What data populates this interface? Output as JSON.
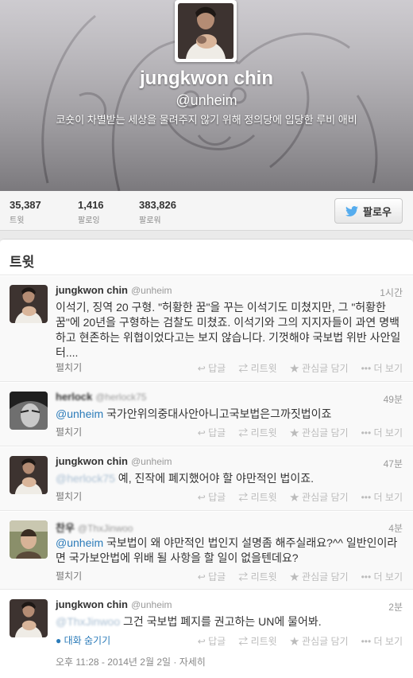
{
  "profile": {
    "name": "jungkwon chin",
    "handle": "@unheim",
    "bio": "코숏이 차별받는 세상을 물려주지 않기 위해 정의당에 입당한 루비 애비"
  },
  "stats": [
    {
      "num": "35,387",
      "label": "트윗"
    },
    {
      "num": "1,416",
      "label": "팔로잉"
    },
    {
      "num": "383,826",
      "label": "팔로워"
    }
  ],
  "follow_label": "팔로우",
  "timeline_title": "트윗",
  "actions": {
    "reply": "답글",
    "retweet": "리트윗",
    "favorite": "관심글 담기",
    "more": "더 보기"
  },
  "expand_label": "펼치기",
  "collapse_label": "대화 숨기기",
  "tweets": [
    {
      "name": "jungkwon chin",
      "screen_name": "@unheim",
      "time": "1시간",
      "text": "이석기, 징역 20 구형. \"허황한 꿈\"을 꾸는 이석기도 미쳤지만, 그 \"허황한 꿈\"에 20년을 구형하는 검찰도 미쳤죠. 이석기와 그의 지지자들이 과연 명백하고 현존하는 위협이었다고는 보지 않습니다. 기껏해야 국보법 위반 사안일 터...."
    },
    {
      "name": "herlock",
      "screen_name": "@herlock75",
      "time": "49분",
      "mention": "@unheim",
      "text": " 국가안위의중대사안아니고국보법은그까짓법이죠"
    },
    {
      "name": "jungkwon chin",
      "screen_name": "@unheim",
      "time": "47분",
      "mention": "@herlock75",
      "text": " 예, 진작에 폐지했어야 할 야만적인 법이죠."
    },
    {
      "name": "찬우",
      "screen_name": "@ThxJinwoo",
      "time": "4분",
      "mention": "@unheim",
      "text": " 국보법이 왜 야만적인 법인지 설명좀 해주실래요?^^ 일반인이라면 국가보안법에 위배 될 사항을 할 일이 없을텐데요?"
    },
    {
      "name": "jungkwon chin",
      "screen_name": "@unheim",
      "time": "2분",
      "mention": "@ThxJinwoo",
      "text": " 그건 국보법 폐지를 권고하는 UN에 물어봐."
    }
  ],
  "footer_meta": "오후 11:28 - 2014년 2월 2일 · 자세히",
  "colors": {
    "link": "#2b7bb9",
    "twitter_blue": "#55acee"
  }
}
